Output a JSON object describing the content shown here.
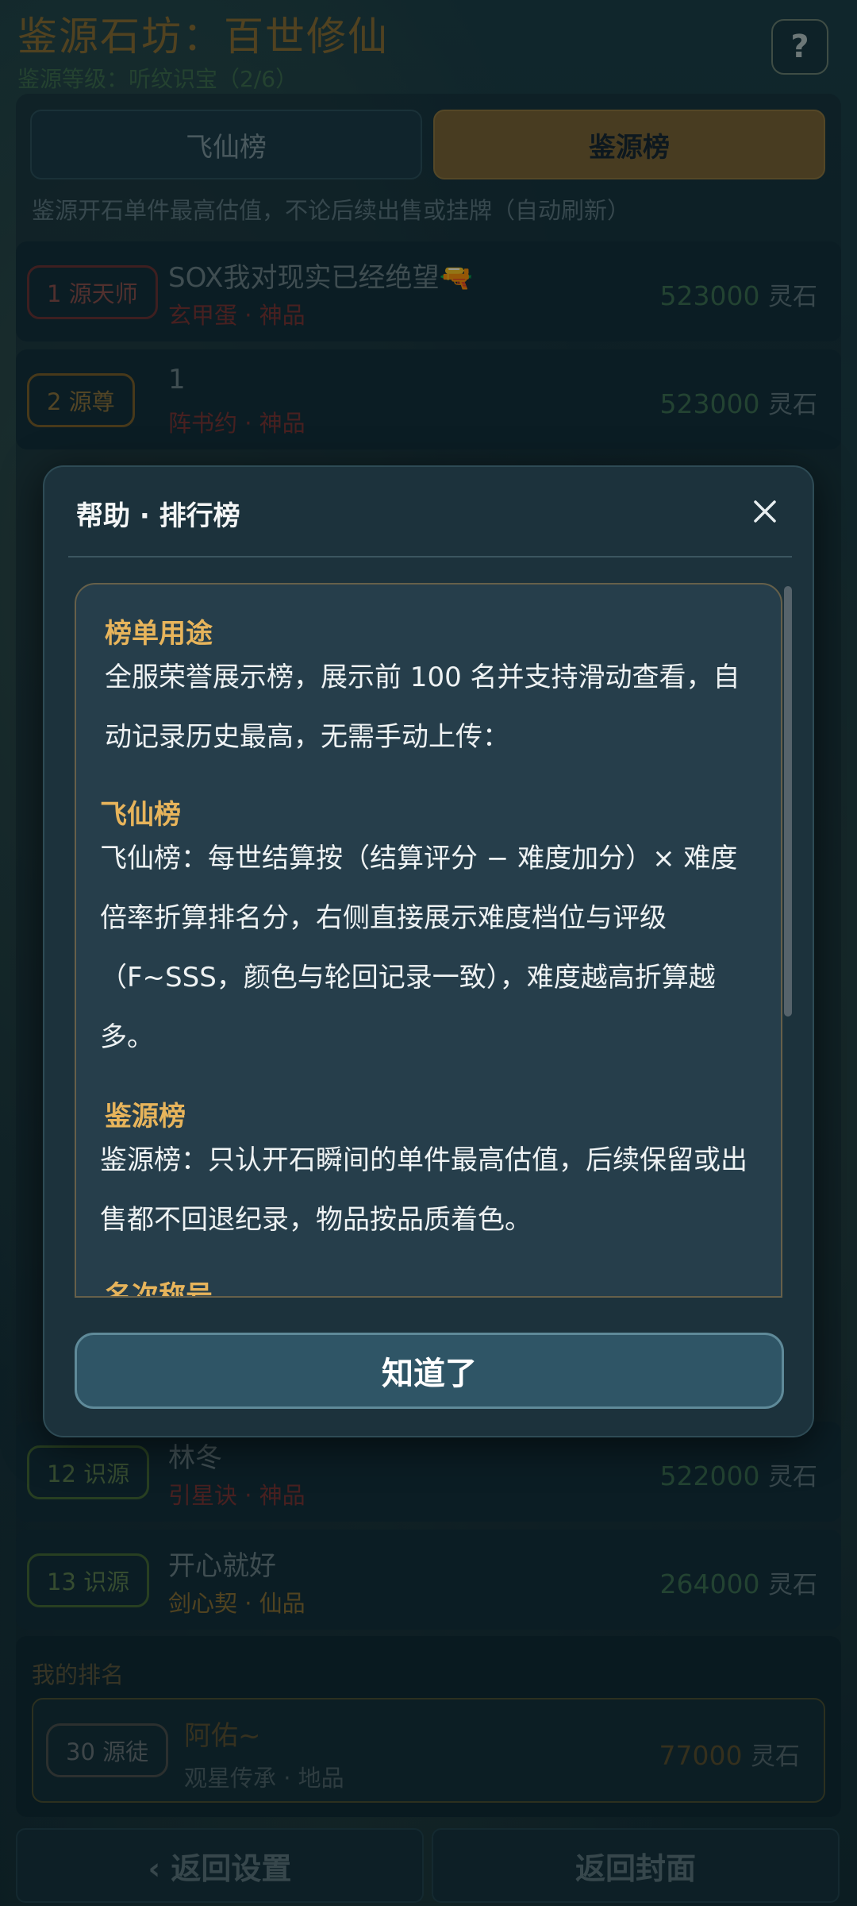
{
  "page": {
    "title": "鉴源石坊：百世修仙",
    "subtitle": "鉴源等级：听纹识宝（2/6）",
    "help_label": "?"
  },
  "tabs": [
    {
      "label": "飞仙榜",
      "active": false
    },
    {
      "label": "鉴源榜",
      "active": true
    }
  ],
  "tab_description": "鉴源开石单件最高估值，不论后续出售或挂牌（自动刷新）",
  "ranking": [
    {
      "badge": "1 源天师",
      "name": "SOX我对现实已经绝望🔫",
      "sub": "玄甲蛋 · 神品",
      "score": "523000",
      "unit": "灵石"
    },
    {
      "badge": "2 源尊",
      "name": "1",
      "sub": "阵书约 · 神品",
      "score": "523000",
      "unit": "灵石"
    },
    {
      "badge": "12 识源",
      "name": "林冬",
      "sub": "引星诀 · 神品",
      "score": "522000",
      "unit": "灵石"
    },
    {
      "badge": "13 识源",
      "name": "开心就好",
      "sub": "剑心契 · 仙品",
      "score": "264000",
      "unit": "灵石"
    }
  ],
  "my_rank": {
    "label": "我的排名",
    "badge": "30 源徒",
    "name": "阿佑~",
    "sub": "观星传承 · 地品",
    "score": "77000",
    "unit": "灵石"
  },
  "bottom": {
    "back_label": "‹ 返回设置",
    "cover_label": "返回封面"
  },
  "modal": {
    "title": "帮助 · 排行榜",
    "close_icon": "close-icon",
    "sections": [
      {
        "title": "榜单用途",
        "body": "全服荣誉展示榜，展示前 100 名并支持滑动查看，自动记录历史最高，无需手动上传："
      },
      {
        "title": "飞仙榜",
        "body": "飞仙榜：每世结算按（结算评分 − 难度加分）× 难度倍率折算排名分，右侧直接展示难度档位与评级（F~SSS，颜色与轮回记录一致），难度越高折算越多。"
      },
      {
        "title": "鉴源榜",
        "body": "鉴源榜：只认开石瞬间的单件最高估值，后续保留或出售都不回退纪录，物品按品质着色。"
      },
      {
        "title": "名次称号",
        "body": ""
      }
    ],
    "ok_label": "知道了"
  },
  "colors": {
    "accent_gold": "#e7b45b",
    "modal_bg": "#1c323c",
    "score_green": "#3c6b4a",
    "quality_red": "#7a302c"
  }
}
